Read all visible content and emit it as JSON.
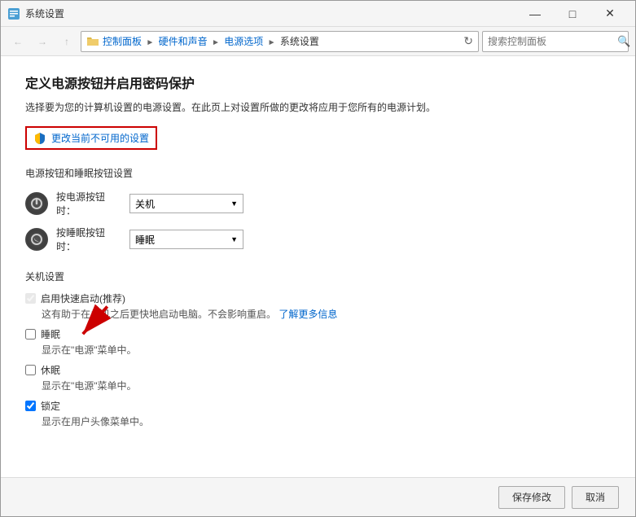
{
  "window": {
    "title": "系统设置",
    "minimize_label": "—",
    "maximize_label": "□",
    "close_label": "✕"
  },
  "nav": {
    "back_label": "←",
    "forward_label": "→",
    "up_label": "↑",
    "breadcrumb": {
      "parts": [
        "控制面板",
        "硬件和声音",
        "电源选项",
        "系统设置"
      ]
    },
    "refresh_label": "↻",
    "search_placeholder": "搜索控制面板"
  },
  "page": {
    "title": "定义电源按钮并启用密码保护",
    "subtitle": "选择要为您的计算机设置的电源设置。在此页上对设置所做的更改将应用于您所有的电源计划。",
    "change_settings_label": "更改当前不可用的设置",
    "power_buttons_section": "电源按钮和睡眠按钮设置",
    "power_btn_label": "按电源按钮时：",
    "power_btn_value": "关机",
    "sleep_btn_label": "按睡眠按钮时：",
    "sleep_btn_value": "睡眠",
    "shutdown_section": "关机设置",
    "fast_startup_label": "启用快速启动(推荐)",
    "fast_startup_desc": "这有助于在关机之后更快地启动电脑。不会影响重启。",
    "learn_more_label": "了解更多信息",
    "sleep_label": "睡眠",
    "sleep_desc": "显示在\"电源\"菜单中。",
    "hibernate_label": "休眠",
    "hibernate_desc": "显示在\"电源\"菜单中。",
    "lock_label": "锁定",
    "lock_desc": "显示在用户头像菜单中。"
  },
  "bottom": {
    "save_label": "保存修改",
    "cancel_label": "取消"
  }
}
